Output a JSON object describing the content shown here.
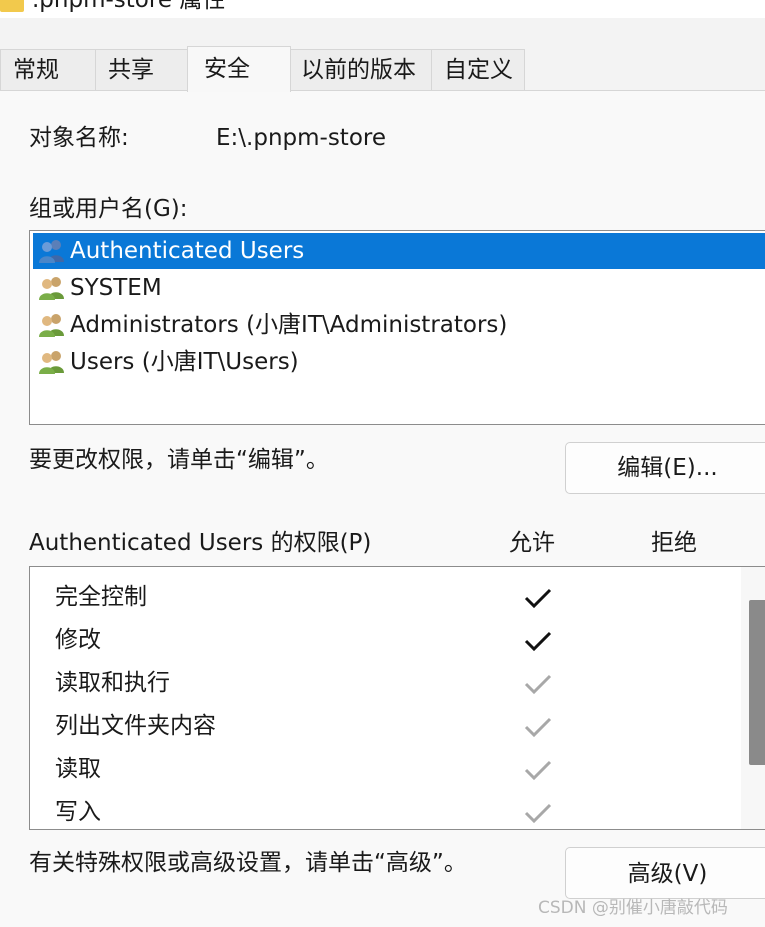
{
  "window": {
    "title": ".pnpm-store 属性"
  },
  "tabs": [
    {
      "label": "常规"
    },
    {
      "label": "共享"
    },
    {
      "label": "安全"
    },
    {
      "label": "以前的版本"
    },
    {
      "label": "自定义"
    }
  ],
  "active_tab": "安全",
  "object": {
    "label": "对象名称:",
    "value": "E:\\.pnpm-store"
  },
  "groups": {
    "label": "组或用户名(G):",
    "items": [
      {
        "name": "Authenticated Users",
        "selected": true,
        "icon": "user-group-icon"
      },
      {
        "name": "SYSTEM",
        "selected": false,
        "icon": "user-group-icon"
      },
      {
        "name": "Administrators (小唐IT\\Administrators)",
        "selected": false,
        "icon": "user-group-icon"
      },
      {
        "name": "Users (小唐IT\\Users)",
        "selected": false,
        "icon": "user-group-icon"
      }
    ]
  },
  "edit": {
    "hint": "要更改权限，请单击“编辑”。",
    "button_label": "编辑(E)..."
  },
  "permissions": {
    "header": "Authenticated Users 的权限(P)",
    "allow_label": "允许",
    "deny_label": "拒绝",
    "rows": [
      {
        "name": "完全控制",
        "allow": "checked",
        "deny": "none"
      },
      {
        "name": "修改",
        "allow": "checked",
        "deny": "none"
      },
      {
        "name": "读取和执行",
        "allow": "checked-inherited",
        "deny": "none"
      },
      {
        "name": "列出文件夹内容",
        "allow": "checked-inherited",
        "deny": "none"
      },
      {
        "name": "读取",
        "allow": "checked-inherited",
        "deny": "none"
      },
      {
        "name": "写入",
        "allow": "checked-inherited",
        "deny": "none"
      }
    ]
  },
  "advanced": {
    "hint": "有关特殊权限或高级设置，请单击“高级”。",
    "button_label": "高级(V)"
  },
  "watermark": "CSDN @别催小唐敲代码",
  "colors": {
    "selection": "#0a78d7",
    "check_active": "#111111",
    "check_inherited": "#a8a8a8",
    "folder": "#f2c94c"
  }
}
